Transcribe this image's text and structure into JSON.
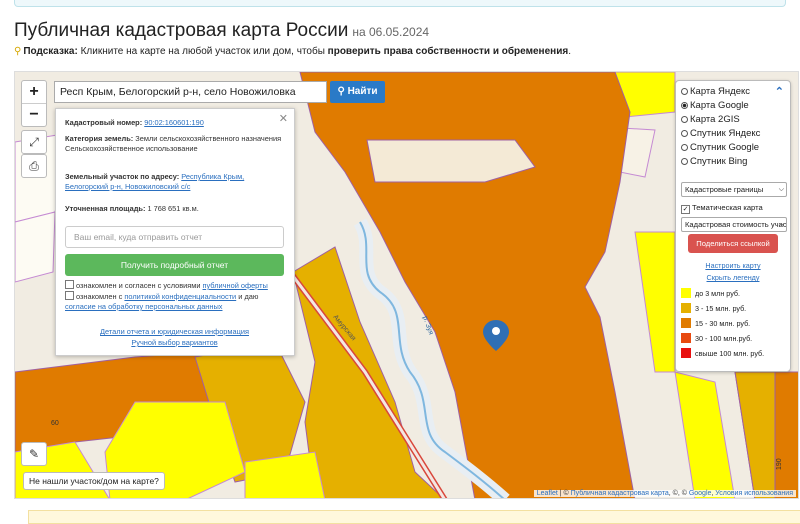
{
  "header": {
    "title": "Публичная кадастровая карта России",
    "date": "на 06.05.2024"
  },
  "hint": {
    "label": "Подсказка:",
    "text": " Кликните на карте на любой участок или дом, чтобы ",
    "bold": "проверить права собственности и обременения",
    "end": "."
  },
  "search": {
    "value": "Респ Крым, Белогорский р-н, село Новожиловка",
    "button": "Найти"
  },
  "popup": {
    "cadastral_label": "Кадастровый номер:",
    "cadastral_number": "90:02:160601:190",
    "category_label": "Категория земель:",
    "category_value": "Земли сельскохозяйственного назначения",
    "use_value": "Сельскохозяйственное использование",
    "address_label": "Земельный участок по адресу:",
    "address_value": "Республика Крым, Белогорский р-н, Новожиловский с/с",
    "area_label": "Уточненная площадь:",
    "area_value": "1 768 651 кв.м.",
    "email_placeholder": "Ваш email, куда отправить отчет",
    "report_button": "Получить подробный отчет",
    "agree1_text": "ознакомлен и согласен с условиями ",
    "agree1_link": "публичной оферты",
    "agree2_text": "ознакомлен с ",
    "agree2_link": "политикой конфиденциальности",
    "agree2_text2": " и даю ",
    "agree2_link2": "согласие на обработку персональных данных",
    "details_link": "Детали отчета и юридическая информация",
    "manual_link": "Ручной выбор вариантов"
  },
  "layers": {
    "options": [
      {
        "label": "Карта Яндекс",
        "selected": false
      },
      {
        "label": "Карта Google",
        "selected": true
      },
      {
        "label": "Карта 2GIS",
        "selected": false
      },
      {
        "label": "Спутник Яндекс",
        "selected": false
      },
      {
        "label": "Спутник Google",
        "selected": false
      },
      {
        "label": "Спутник Bing",
        "selected": false
      }
    ],
    "overlay_select": "Кадастровые границы",
    "thematic_label": "Тематическая карта",
    "thematic_select": "Кадастровая стоимость участков",
    "share_button": "Поделиться ссылкой",
    "setup_link": "Настроить карту",
    "hide_legend_link": "Скрыть легенду",
    "legend": [
      {
        "label": "до 3 млн руб.",
        "color": "#ffff00"
      },
      {
        "label": "3 - 15 млн. руб.",
        "color": "#e5b000"
      },
      {
        "label": "15 - 30 млн. руб.",
        "color": "#e07b00"
      },
      {
        "label": "30 - 100 млн.руб.",
        "color": "#e84a10"
      },
      {
        "label": "свыше 100 млн. руб.",
        "color": "#e81010"
      }
    ]
  },
  "map": {
    "not_found_button": "Не нашли участок/дом на карте?",
    "attribution_leaflet": "Leaflet",
    "attribution_sep1": " | © ",
    "attribution_pkk": "Публичная кадастровая карта",
    "attribution_mid": ", ©, © ",
    "attribution_google": "Google",
    "attribution_sep2": ", ",
    "attribution_terms": "Условия использования",
    "label_60": "60",
    "label_190": "190",
    "road_label": "Амурская",
    "river_label": "р. Зуя"
  }
}
